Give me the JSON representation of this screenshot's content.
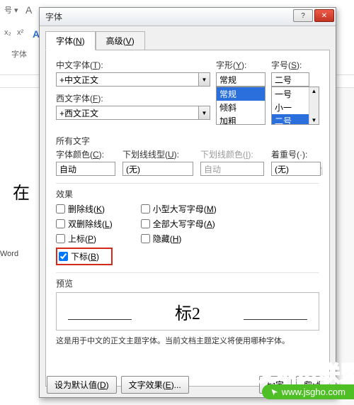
{
  "ribbon": {
    "size_dd": "号 ▾",
    "font_caps_A": "A",
    "font_small_a": "A",
    "blue_A": "A",
    "subscript_btn": "x₂",
    "superscript_btn": "x²",
    "font_group": "字体"
  },
  "doc": {
    "char": "在",
    "status": "Word"
  },
  "dialog": {
    "title": "字体",
    "close": "✕",
    "help": "?",
    "tabs": {
      "font": "字体(N)",
      "adv": "高级(V)",
      "font_u": "N",
      "adv_u": "V"
    },
    "cn": {
      "label": "中文字体(T):",
      "u": "T",
      "value": "+中文正文"
    },
    "xing": {
      "label": "字形(Y):",
      "u": "Y",
      "value": "常规",
      "opts": [
        "常规",
        "倾斜",
        "加粗"
      ],
      "selected": 0
    },
    "hao": {
      "label": "字号(S):",
      "u": "S",
      "value": "二号",
      "opts": [
        "一号",
        "小一",
        "二号"
      ],
      "selected": 2
    },
    "west": {
      "label": "西文字体(F):",
      "u": "F",
      "value": "+西文正文"
    },
    "all_text": "所有文字",
    "color": {
      "label": "字体颜色(C):",
      "u": "C",
      "value": "自动"
    },
    "uline_type": {
      "label": "下划线线型(U):",
      "u": "U",
      "value": "(无)"
    },
    "uline_color": {
      "label": "下划线颜色(I):",
      "u": "I",
      "value": "自动"
    },
    "emph": {
      "label": "着重号(·):",
      "value": "(无)"
    },
    "fx_title": "效果",
    "fx": {
      "strike": "删除线(K)",
      "dstrike": "双删除线(L)",
      "super": "上标(P)",
      "sub": "下标(B)",
      "smallcaps": "小型大写字母(M)",
      "allcaps": "全部大写字母(A)",
      "hidden": "隐藏(H)",
      "sub_checked": true
    },
    "preview_title": "预览",
    "preview_text": "标2",
    "preview_note": "这是用于中文的正文主题字体。当前文档主题定义将使用哪种字体。",
    "btn_default": "设为默认值(D)",
    "btn_texteffect": "文字效果(E)...",
    "btn_ok": "确定",
    "btn_cancel": "取消"
  },
  "watermark": {
    "brand": "技术员联盟",
    "url": "www.jsgho.com"
  }
}
